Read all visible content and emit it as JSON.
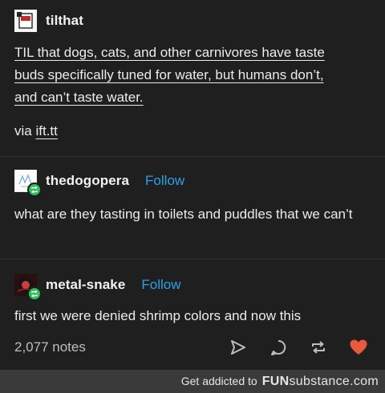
{
  "post": {
    "op": {
      "username": "tilthat"
    },
    "op_body": {
      "line1": "TIL that dogs, cats, and other carnivores have taste",
      "line2": "buds specifically tuned for water, but humans don’t,",
      "line3": "and can’t taste water.",
      "via_label": "via",
      "via_link": "ift.tt"
    },
    "reblog1": {
      "username": "thedogopera",
      "follow_label": "Follow",
      "text": "what are they tasting in toilets and puddles that we can’t"
    },
    "reblog2": {
      "username": "metal-snake",
      "follow_label": "Follow",
      "text": "first we were denied shrimp colors and now this"
    },
    "notes_count": "2,077 notes",
    "icons": [
      "share-icon",
      "reply-icon",
      "reblog-icon",
      "like-heart-icon"
    ],
    "colors": {
      "follow": "#2aa1e6",
      "reblog_badge": "#2fbf5a",
      "heart": "#e8593e"
    }
  },
  "footer": {
    "prefix": "Get addicted to",
    "brand_fun": "FUN",
    "brand_sub": "substance",
    "brand_tld": ".com"
  }
}
